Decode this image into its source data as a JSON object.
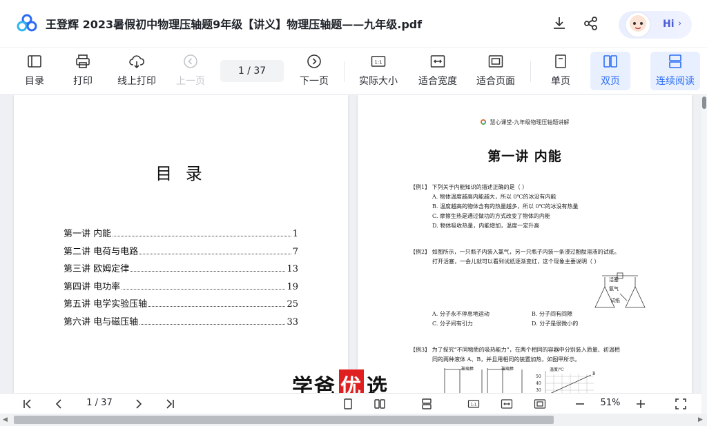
{
  "window": {
    "title": "王登辉 2023暑假初中物理压轴题9年级【讲义】物理压轴题——九年级.pdf",
    "hi_label": "Hi"
  },
  "toolbar": {
    "items": [
      {
        "label": "目录",
        "icon": "toc-icon"
      },
      {
        "label": "打印",
        "icon": "printer-icon"
      },
      {
        "label": "线上打印",
        "icon": "cloud-print-icon"
      },
      {
        "label": "上一页",
        "icon": "prev-page-icon"
      },
      {
        "label": "下一页",
        "icon": "next-page-icon"
      },
      {
        "label": "实际大小",
        "icon": "actual-size-icon"
      },
      {
        "label": "适合宽度",
        "icon": "fit-width-icon"
      },
      {
        "label": "适合页面",
        "icon": "fit-page-icon"
      },
      {
        "label": "单页",
        "icon": "single-page-icon"
      },
      {
        "label": "双页",
        "icon": "double-page-icon"
      },
      {
        "label": "连续阅读",
        "icon": "continuous-icon"
      }
    ],
    "page_indicator": "1  /  37",
    "active_color": "#2b6cf5"
  },
  "left_page": {
    "title": "目 录",
    "toc": [
      {
        "label": "第一讲  内能",
        "page": "1"
      },
      {
        "label": "第二讲  电荷与电路",
        "page": "7"
      },
      {
        "label": "第三讲  欧姆定律",
        "page": "13"
      },
      {
        "label": "第四讲  电功率",
        "page": "19"
      },
      {
        "label": "第五讲  电学实验压轴",
        "page": "25"
      },
      {
        "label": "第六讲  电与磁压轴",
        "page": "33"
      }
    ]
  },
  "right_page": {
    "header": "慧心课堂-九年级物理压轴题讲解",
    "title": "第一讲  内能",
    "ex1": "【例1】 下列关于内能知识的描述正确的是（     ）",
    "ex1_opts": [
      "A. 物体温度越高内能越大，所以 0℃的冰没有内能",
      "B. 温度越高的物体含有的热量越多，所以 0℃的冰没有热量",
      "C. 摩擦生热是通过做功的方式改变了物体的内能",
      "D. 物体吸收热量，内能增加，温度一定升高"
    ],
    "ex2_line1": "【例2】 如图所示，一只瓶子内装入氯气，另一只瓶子内装一条浸过酚酞溶液的试纸。",
    "ex2_line2": "打开活塞，一会儿就可以看到试纸逐渐变红，这个现象主要说明（     ）",
    "ex2_fig_labels": [
      "活塞",
      "氨气",
      "试纸"
    ],
    "ex2_opts": [
      "A. 分子永不停息地运动",
      "B. 分子间有间隙",
      "C. 分子间有引力",
      "D. 分子是很微小的"
    ],
    "ex3_line1": "【例3】 为了探究“不同物质的吸热能力”，在两个相同的容器中分别装入质量、初温相",
    "ex3_line2": "同的两种液体 A、B，并且用相同的装置加热，如图甲所示。",
    "ex3_fig_labels": [
      "玻璃棒",
      "玻璃棒",
      "温度/℃",
      "50",
      "40",
      "30",
      "B"
    ]
  },
  "watermark": {
    "text_before": "学爸",
    "text_highlight": "优",
    "text_after": "选"
  },
  "bottombar": {
    "page_indicator": "1  /  37",
    "zoom": "51%"
  }
}
